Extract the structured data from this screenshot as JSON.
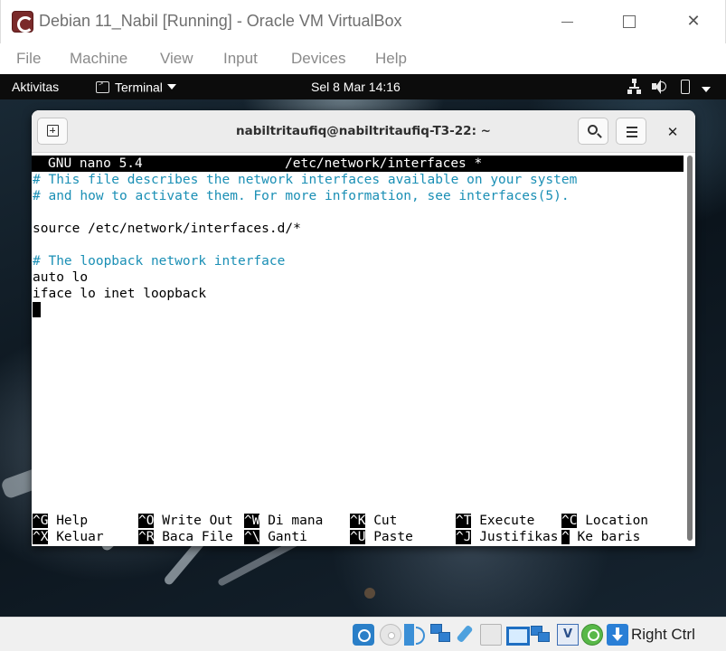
{
  "vbox": {
    "title": "Debian 11_Nabil [Running] - Oracle VM VirtualBox",
    "menu": [
      "File",
      "Machine",
      "View",
      "Input",
      "Devices",
      "Help"
    ],
    "host_key": "Right Ctrl",
    "status_cpu_label": "V",
    "status_icons": [
      "hard-disk-icon",
      "optical-drive-icon",
      "audio-icon",
      "network-icon",
      "usb-icon",
      "shared-folders-icon",
      "display-icon",
      "video-capture-icon",
      "cpu-icon",
      "mouse-integration-icon",
      "keyboard-icon"
    ]
  },
  "gnome": {
    "activities": "Aktivitas",
    "app_name": "Terminal",
    "clock": "Sel 8 Mar  14:16",
    "tray_icons": [
      "network-wired-icon",
      "volume-icon",
      "battery-icon",
      "system-menu-caret-icon"
    ]
  },
  "terminal": {
    "title": "nabiltritaufiq@nabiltritaufiq-T3-22: ~",
    "close_glyph": "✕"
  },
  "nano": {
    "version": "GNU nano 5.4",
    "file": "/etc/network/interfaces *",
    "lines": [
      {
        "text": "# This file describes the network interfaces available on your system",
        "kind": "comment"
      },
      {
        "text": "# and how to activate them. For more information, see interfaces(5).",
        "kind": "comment"
      },
      {
        "text": "",
        "kind": "text"
      },
      {
        "text": "source /etc/network/interfaces.d/*",
        "kind": "text"
      },
      {
        "text": "",
        "kind": "text"
      },
      {
        "text": "# The loopback network interface",
        "kind": "comment"
      },
      {
        "text": "auto lo",
        "kind": "text"
      },
      {
        "text": "iface lo inet loopback",
        "kind": "text"
      }
    ],
    "shortcuts_row1": [
      {
        "key": "^G",
        "label": " Help"
      },
      {
        "key": "^O",
        "label": " Write Out"
      },
      {
        "key": "^W",
        "label": " Di mana"
      },
      {
        "key": "^K",
        "label": " Cut"
      },
      {
        "key": "^T",
        "label": " Execute"
      },
      {
        "key": "^C",
        "label": " Location"
      }
    ],
    "shortcuts_row2": [
      {
        "key": "^X",
        "label": " Keluar"
      },
      {
        "key": "^R",
        "label": " Baca File"
      },
      {
        "key": "^\\",
        "label": " Ganti"
      },
      {
        "key": "^U",
        "label": " Paste"
      },
      {
        "key": "^J",
        "label": " Justifikas"
      },
      {
        "key": "^",
        "label": " Ke baris"
      }
    ]
  }
}
